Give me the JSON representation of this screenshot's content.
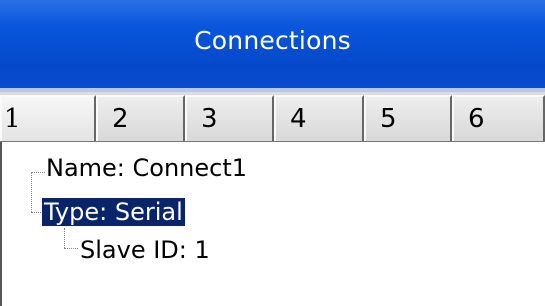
{
  "window": {
    "title": "Connections"
  },
  "tabs": [
    "1",
    "2",
    "3",
    "4",
    "5",
    "6"
  ],
  "tree": {
    "name": "Name: Connect1",
    "type": "Type: Serial",
    "slave_id": "Slave ID: 1"
  },
  "colors": {
    "title_bar": "#0548c9",
    "selection": "#0a246a",
    "tab_bg": "#dcdcdc"
  }
}
